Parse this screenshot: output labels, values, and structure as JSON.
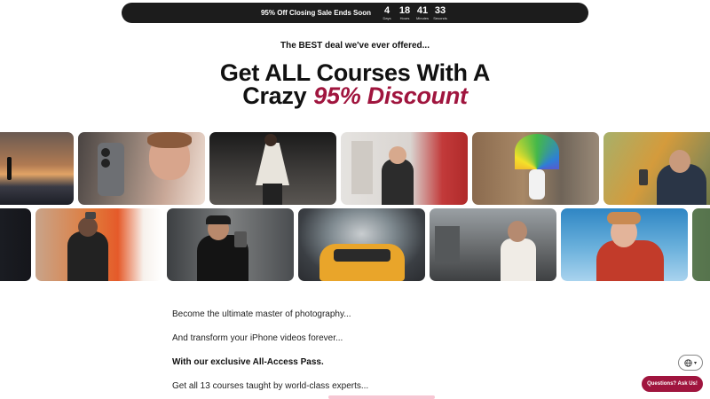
{
  "countdown_bar": {
    "sale_text": "95% Off Closing Sale Ends Soon",
    "units": [
      {
        "value": "4",
        "label": "Days"
      },
      {
        "value": "18",
        "label": "Hours"
      },
      {
        "value": "41",
        "label": "Minutes"
      },
      {
        "value": "33",
        "label": "Seconds"
      }
    ]
  },
  "hero": {
    "pretitle": "The BEST deal we've ever offered...",
    "title_line1": "Get ALL Courses With A",
    "title_line2_prefix": "Crazy",
    "title_line2_accent": "95% Discount",
    "accent_color": "#a0153e"
  },
  "gallery": {
    "row1": [
      "sunset-beach-photo",
      "iphone-closeup-photo",
      "fashion-low-angle-photo",
      "street-alley-photo",
      "rainbow-umbrella-photo",
      "autumn-park-photo"
    ],
    "row2": [
      "dark-edge-photo",
      "red-shop-photo",
      "city-filming-photo",
      "taxi-zoom-blur-photo",
      "street-portrait-photo",
      "red-jacket-photo",
      "edge-photo"
    ]
  },
  "body_copy": [
    "Become the ultimate master of photography...",
    "And transform your iPhone videos forever...",
    "With our exclusive All-Access Pass.",
    "Get all 13 courses taught by world-class experts..."
  ],
  "widgets": {
    "language_icon": "globe-icon",
    "ask_button": "Questions? Ask Us!"
  }
}
